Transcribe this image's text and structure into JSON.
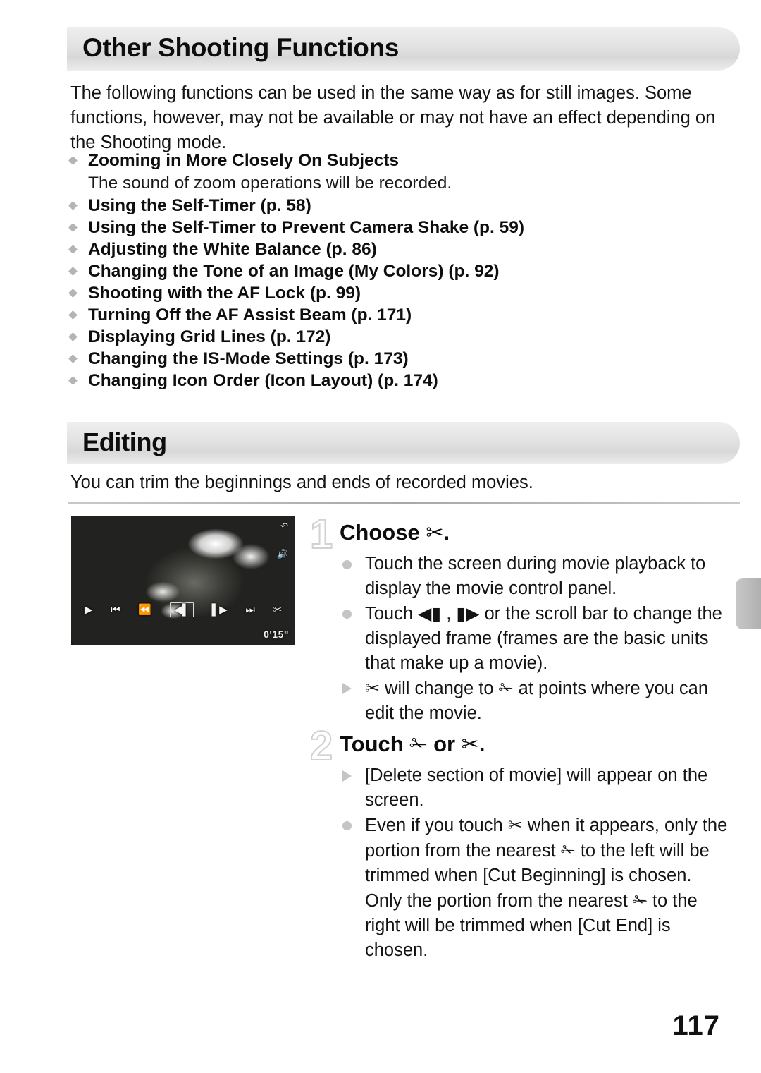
{
  "page": {
    "number": "117",
    "tab_marker": "chapter-tab"
  },
  "sections": {
    "shooting": {
      "banner_title": "Other Shooting Functions",
      "intro": "The following functions can be used in the same way as for still images. Some functions, however, may not be available or may not have an effect depending on the Shooting mode.",
      "items": [
        {
          "label": "Zooming in More Closely On Subjects",
          "note": "The sound of zoom operations will be recorded."
        },
        {
          "label": "Using the Self-Timer (p. 58)",
          "note": ""
        },
        {
          "label": "Using the Self-Timer to Prevent Camera Shake (p. 59)",
          "note": ""
        },
        {
          "label": "Adjusting the White Balance (p. 86)",
          "note": ""
        },
        {
          "label": "Changing the Tone of an Image (My Colors) (p. 92)",
          "note": ""
        },
        {
          "label": "Shooting with the AF Lock (p. 99)",
          "note": ""
        },
        {
          "label": "Turning Off the AF Assist Beam (p. 171)",
          "note": ""
        },
        {
          "label": "Displaying Grid Lines (p. 172)",
          "note": ""
        },
        {
          "label": "Changing the IS-Mode Settings (p. 173)",
          "note": ""
        },
        {
          "label": "Changing Icon Order (Icon Layout) (p. 174)",
          "note": ""
        }
      ]
    },
    "editing": {
      "banner_title": "Editing",
      "intro": "You can trim the beginnings and ends of recorded movies."
    }
  },
  "lcd_screenshot": {
    "label": "movie-playback-screen",
    "top_icons": [
      "return-arrow-icon",
      "volume-icon"
    ],
    "control_icons": [
      "play-icon",
      "skip-back-icon",
      "prev-frame-icon",
      "reverse-frame-icon",
      "forward-frame-icon",
      "next-frame-icon",
      "scissors-icon"
    ],
    "timestamp": "0'15\""
  },
  "steps": [
    {
      "number": "1",
      "heading_prefix": "Choose",
      "heading_icon": "✂",
      "heading_suffix": ".",
      "notes": [
        {
          "bullet": "dot",
          "parts": [
            {
              "t": "text",
              "v": "Touch the screen during movie playback to display the movie control panel."
            }
          ]
        },
        {
          "bullet": "dot",
          "parts": [
            {
              "t": "text",
              "v": "Touch "
            },
            {
              "t": "icon",
              "v": "◀▮",
              "name": "reverse-frame-icon"
            },
            {
              "t": "text",
              "v": " , "
            },
            {
              "t": "icon",
              "v": "▮▶",
              "name": "forward-frame-icon"
            },
            {
              "t": "text",
              "v": " or the scroll bar to change the displayed frame (frames are the basic units that make up a movie)."
            }
          ]
        },
        {
          "bullet": "triangle",
          "parts": [
            {
              "t": "icon",
              "v": "✂",
              "name": "scissors-icon"
            },
            {
              "t": "text",
              "v": " will change to "
            },
            {
              "t": "icon",
              "v": "✁",
              "name": "cut-point-icon"
            },
            {
              "t": "text",
              "v": " at points where you can edit the movie."
            }
          ]
        }
      ]
    },
    {
      "number": "2",
      "heading_prefix": "Touch",
      "heading_icon": "✁",
      "heading_icon2": "✂",
      "heading_conjunction": "or",
      "heading_suffix": ".",
      "notes": [
        {
          "bullet": "triangle",
          "parts": [
            {
              "t": "text",
              "v": "[Delete section of movie] will appear on the screen."
            }
          ]
        },
        {
          "bullet": "dot",
          "parts": [
            {
              "t": "text",
              "v": "Even if you touch "
            },
            {
              "t": "icon",
              "v": "✂",
              "name": "scissors-icon"
            },
            {
              "t": "text",
              "v": " when it appears, only the portion from the nearest "
            },
            {
              "t": "icon",
              "v": "✁",
              "name": "cut-point-icon"
            },
            {
              "t": "text",
              "v": " to the left will be trimmed when [Cut Beginning] is chosen. Only the portion from the nearest "
            },
            {
              "t": "icon",
              "v": "✁",
              "name": "cut-point-icon"
            },
            {
              "t": "text",
              "v": " to the right will be trimmed when [Cut End] is chosen."
            }
          ]
        }
      ]
    }
  ],
  "colors": {
    "banner_gray": "#e2e2e2",
    "bullet_gray": "#c4c4c4",
    "text_black": "#111111",
    "step_num_outline": "#d2d2d2"
  }
}
